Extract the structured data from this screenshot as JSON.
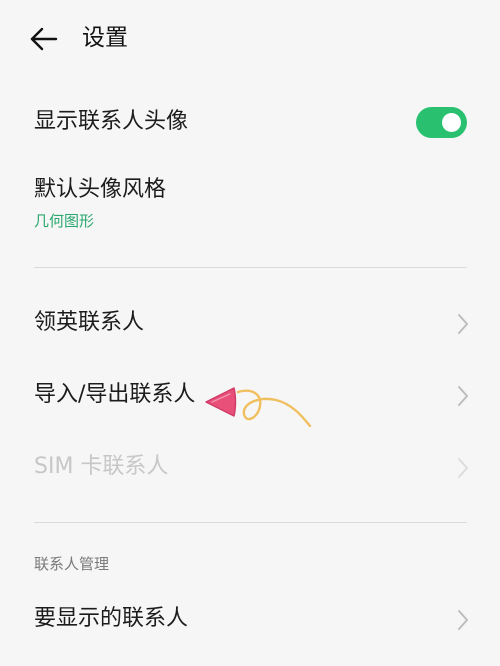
{
  "header": {
    "title": "设置",
    "back_icon": "arrow-left-icon"
  },
  "accent_color": "#29c170",
  "subtitle_color": "#2aa86f",
  "rows": [
    {
      "label": "显示联系人头像",
      "control": "toggle",
      "toggle_on": true
    },
    {
      "label": "默认头像风格",
      "value": "几何图形"
    },
    {
      "label": "领英联系人",
      "icon": "chevron-right-icon"
    },
    {
      "label": "导入/导出联系人",
      "icon": "chevron-right-icon"
    },
    {
      "label": "SIM 卡联系人",
      "icon": "chevron-right-icon",
      "disabled": true
    }
  ],
  "section": {
    "title": "联系人管理",
    "rows": [
      {
        "label": "要显示的联系人",
        "icon": "chevron-right-icon"
      }
    ]
  },
  "annotation": {
    "icon": "hand-drawn-arrow-icon",
    "color": "#e8507a"
  }
}
